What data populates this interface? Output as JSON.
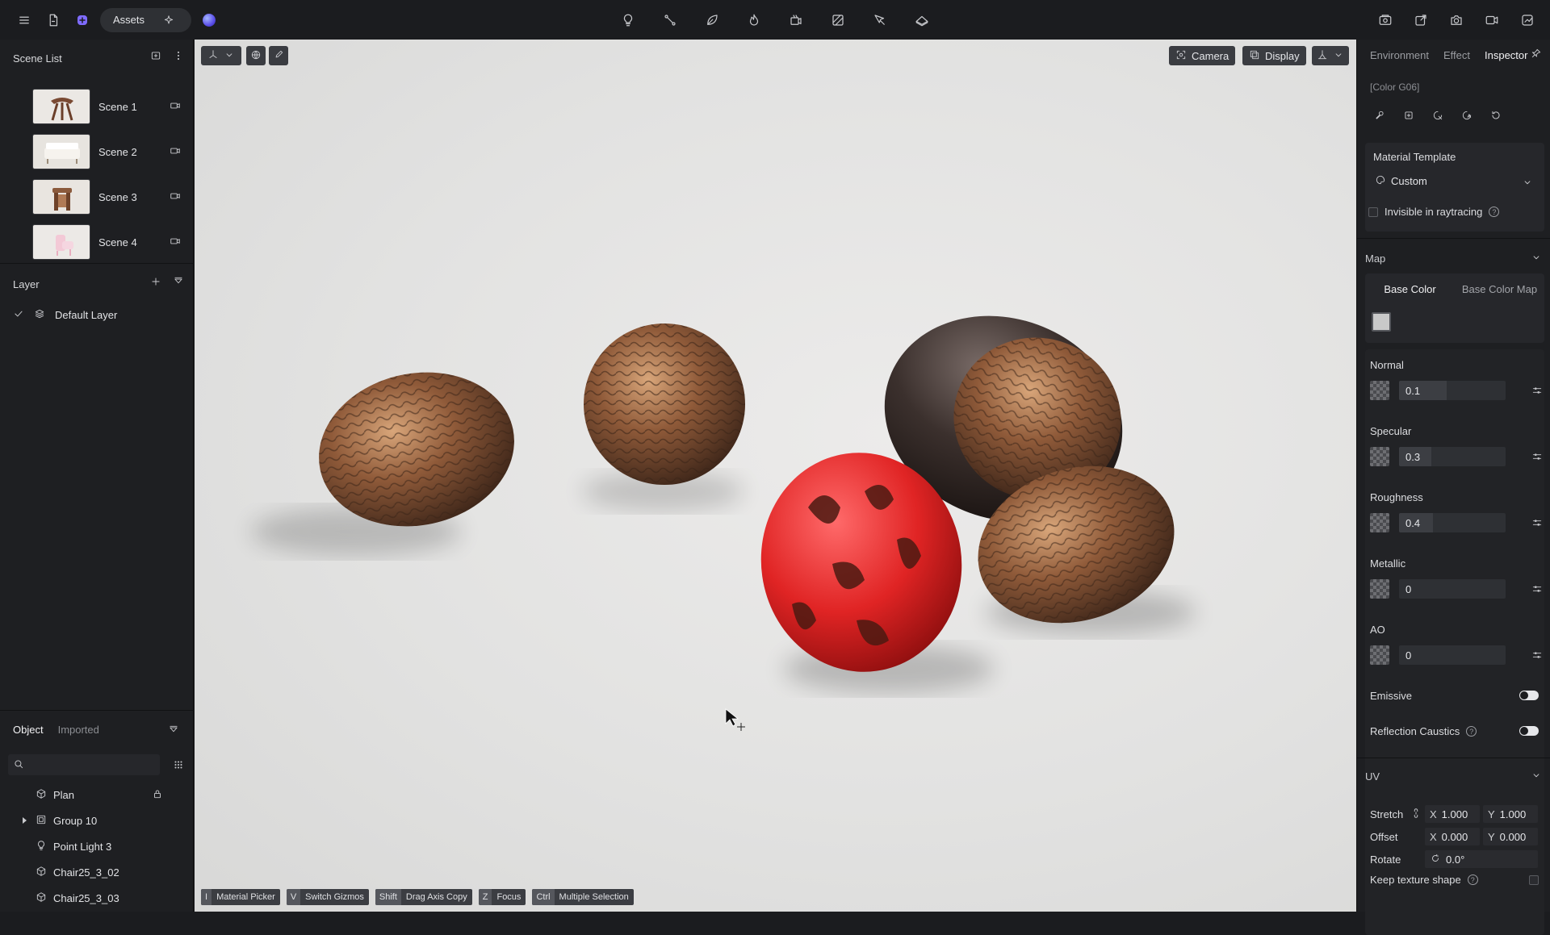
{
  "topbar": {
    "assets_label": "Assets",
    "left_icons": [
      "menu-icon",
      "file-icon",
      "plugin-icon",
      "ai-sparkle-icon",
      "orb-icon"
    ],
    "center_icons": [
      "light-bulb-icon",
      "path-icon",
      "leaf-icon",
      "fire-icon",
      "video-edit-icon",
      "material-icon",
      "pen-tool-icon",
      "ground-icon"
    ],
    "right_icons": [
      "render-icon",
      "export-icon",
      "camera-icon",
      "video-icon",
      "share-icon"
    ]
  },
  "scene_list": {
    "title": "Scene List",
    "scenes": [
      {
        "label": "Scene 1"
      },
      {
        "label": "Scene 2"
      },
      {
        "label": "Scene 3"
      },
      {
        "label": "Scene 4"
      }
    ]
  },
  "layer": {
    "title": "Layer",
    "items": [
      {
        "label": "Default Layer"
      }
    ]
  },
  "objects": {
    "tabs": [
      "Object",
      "Imported"
    ],
    "search_placeholder": "",
    "items": [
      {
        "label": "Plan",
        "icon": "cube-icon"
      },
      {
        "label": "Group 10",
        "icon": "group-icon"
      },
      {
        "label": "Point Light 3",
        "icon": "light-bulb-icon"
      },
      {
        "label": "Chair25_3_02",
        "icon": "cube-icon"
      },
      {
        "label": "Chair25_3_03",
        "icon": "cube-icon"
      }
    ]
  },
  "viewport": {
    "camera_label": "Camera",
    "display_label": "Display",
    "hints": [
      {
        "key": "I",
        "text": "Material Picker"
      },
      {
        "key": "V",
        "text": "Switch Gizmos"
      },
      {
        "key": "Shift",
        "text": "Drag Axis Copy"
      },
      {
        "key": "Z",
        "text": "Focus"
      },
      {
        "key": "Ctrl",
        "text": "Multiple Selection"
      }
    ]
  },
  "inspector": {
    "tabs": [
      "Environment",
      "Effect",
      "Inspector"
    ],
    "material_name": "[Color G06]",
    "material_template": {
      "title": "Material Template",
      "value": "Custom"
    },
    "invisible_raytracing": "Invisible in raytracing",
    "map": {
      "title": "Map",
      "tabs": [
        "Base Color",
        "Base Color Map"
      ],
      "base_color": "#c9c9c9"
    },
    "properties": [
      {
        "label": "Normal",
        "value": "0.1",
        "fraction": 0.45
      },
      {
        "label": "Specular",
        "value": "0.3",
        "fraction": 0.3
      },
      {
        "label": "Roughness",
        "value": "0.4",
        "fraction": 0.32
      },
      {
        "label": "Metallic",
        "value": "0",
        "fraction": 0
      },
      {
        "label": "AO",
        "value": "0",
        "fraction": 0
      }
    ],
    "emissive": "Emissive",
    "reflection_caustics": "Reflection Caustics",
    "uv": {
      "title": "UV",
      "stretch_label": "Stretch",
      "stretch_x": "1.000",
      "stretch_y": "1.000",
      "offset_label": "Offset",
      "offset_x": "0.000",
      "offset_y": "0.000",
      "rotate_label": "Rotate",
      "rotate_value": "0.0°",
      "keep_texture": "Keep texture shape",
      "x_label": "X",
      "y_label": "Y"
    }
  }
}
